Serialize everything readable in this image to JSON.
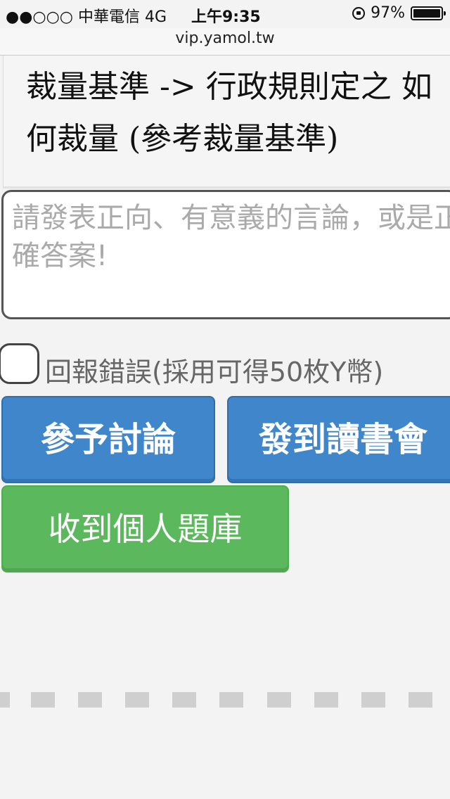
{
  "status_bar": {
    "carrier": "●●○○○ 中華電信  4G",
    "time": "上午9:35",
    "battery": "97%",
    "battery_level": 0.97
  },
  "browser": {
    "url": "vip.yamol.tw"
  },
  "question": {
    "text": "裁量基準 -> 行政規則定之 如何裁量 (參考裁量基準)"
  },
  "comment": {
    "placeholder": "請發表正向、有意義的言論，或是正確答案!",
    "value": ""
  },
  "report": {
    "label": "回報錯誤(採用可得50枚Y幣)",
    "checked": false
  },
  "buttons": {
    "discuss": "參予討論",
    "checkin": "發到讀書會",
    "collect": "收到個人題庫"
  },
  "colors": {
    "blue_button": "#3f86cb",
    "green_button": "#5cb85c"
  },
  "icons": [
    "lock-rotation-icon",
    "battery-icon"
  ]
}
